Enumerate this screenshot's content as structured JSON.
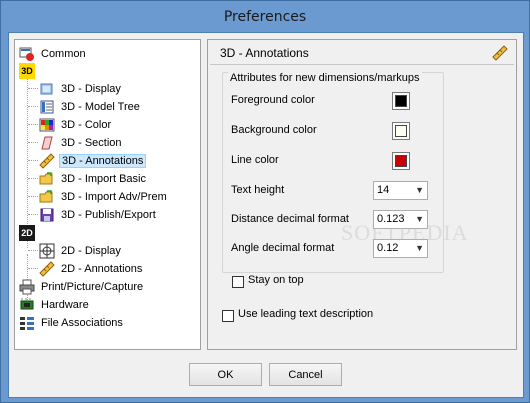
{
  "window": {
    "title": "Preferences"
  },
  "tree": {
    "common": "Common",
    "badge_3d": "3D",
    "items_3d": [
      "3D - Display",
      "3D - Model Tree",
      "3D - Color",
      "3D - Section",
      "3D - Annotations",
      "3D - Import Basic",
      "3D - Import Adv/Prem",
      "3D - Publish/Export"
    ],
    "badge_2d": "2D",
    "items_2d": [
      "2D - Display",
      "2D - Annotations"
    ],
    "print": "Print/Picture/Capture",
    "hardware": "Hardware",
    "file_assoc": "File Associations",
    "selected": "3D - Annotations"
  },
  "panel": {
    "title": "3D - Annotations",
    "group_title": "Attributes for new dimensions/markups",
    "foreground_label": "Foreground color",
    "foreground_color": "#000000",
    "background_label": "Background color",
    "background_color": "#fffff0",
    "line_label": "Line color",
    "line_color": "#cc0000",
    "text_height_label": "Text height",
    "text_height_value": "14",
    "distance_label": "Distance decimal format",
    "distance_value": "0.123",
    "angle_label": "Angle decimal format",
    "angle_value": "0.12",
    "stay_on_top_label": "Stay on top",
    "stay_on_top_checked": false,
    "leading_text_label": "Use leading text description",
    "leading_text_checked": false
  },
  "buttons": {
    "ok": "OK",
    "cancel": "Cancel"
  },
  "watermark": "SOFTPEDIA"
}
